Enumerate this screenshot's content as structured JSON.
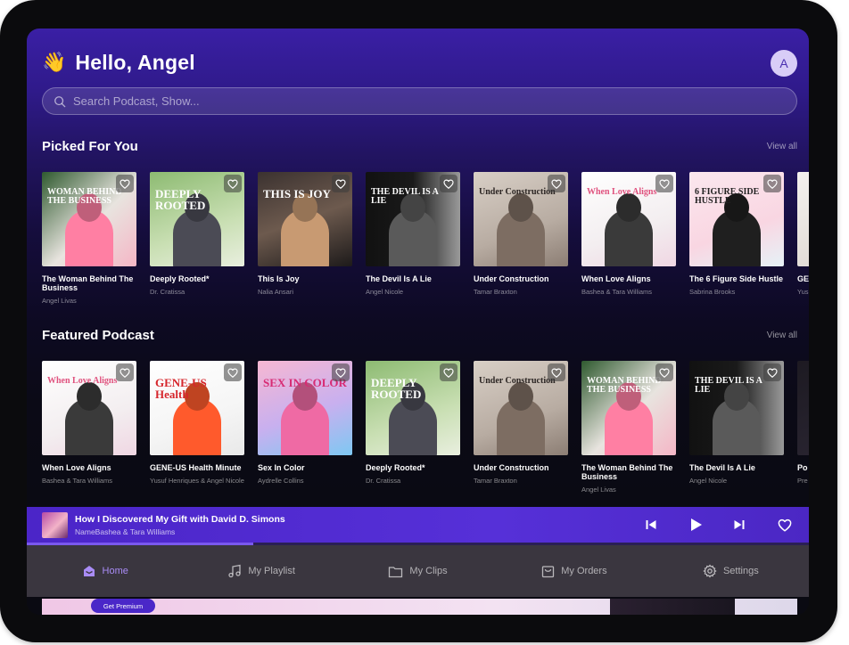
{
  "header": {
    "wave": "👋",
    "greeting": "Hello, Angel",
    "avatar_initial": "A"
  },
  "search": {
    "placeholder": "Search Podcast, Show..."
  },
  "picked": {
    "title": "Picked For You",
    "view_all": "View all",
    "items": [
      {
        "title": "The Woman Behind The Business",
        "sub": "Angel Livas",
        "cover_text": "WOMAN BEHIND THE BUSINESS",
        "bg": "linear-gradient(135deg,#2f5a2f,#e8e4df 55%,#f5b6c6)",
        "text_color": "#ffffff",
        "person": "#ff7fa3"
      },
      {
        "title": "Deeply Rooted*",
        "sub": "Dr. Cratissa",
        "cover_text": "DEEPLY ROOTED",
        "bg": "linear-gradient(160deg,#8dbb72,#c9dfb3 60%,#e9efdf)",
        "text_color": "#ffffff",
        "person": "#4b4b55"
      },
      {
        "title": "This Is Joy",
        "sub": "Nalia Ansari",
        "cover_text": "THIS IS JOY",
        "bg": "linear-gradient(160deg,#3b3230,#6d5a4e 50%,#1d1a1a)",
        "text_color": "#ffffff",
        "person": "#c89a72"
      },
      {
        "title": "The Devil Is A Lie",
        "sub": "Angel Nicole",
        "cover_text": "THE DEVIL IS A LIE",
        "bg": "linear-gradient(90deg,#111 0%,#1a1a1a 50%,#9a9a9a 100%)",
        "text_color": "#ffffff",
        "person": "#5a5a5a"
      },
      {
        "title": "Under Construction",
        "sub": "Tamar Braxton",
        "cover_text": "Under Construction",
        "bg": "linear-gradient(160deg,#d8cfc6,#b8aca2 60%,#8c7e74)",
        "text_color": "#2b2523",
        "person": "#7d6d62"
      },
      {
        "title": "When Love Aligns",
        "sub": "Bashea & Tara Williams",
        "cover_text": "When Love Aligns",
        "bg": "linear-gradient(160deg,#ffffff,#f3eef0 60%,#f0d7e3)",
        "text_color": "#e0517e",
        "person": "#3a3a3a"
      },
      {
        "title": "The 6 Figure Side Hustle",
        "sub": "Sabrina Brooks",
        "cover_text": "6 FIGURE SIDE HUSTLE",
        "bg": "linear-gradient(160deg,#fbe7ee,#f9d6e2 60%,#e6f2f7)",
        "text_color": "#222222",
        "person": "#1f1f1f"
      },
      {
        "title": "GE",
        "sub": "Yus Nic",
        "cover_text": "",
        "bg": "linear-gradient(160deg,#f4f1ee,#dcd6d0)",
        "text_color": "#222222",
        "person": "#cfcfcf"
      }
    ]
  },
  "featured": {
    "title": "Featured Podcast",
    "view_all": "View all",
    "items": [
      {
        "title": "When Love Aligns",
        "sub": "Bashea & Tara Williams",
        "cover_text": "When Love Aligns",
        "bg": "linear-gradient(160deg,#ffffff,#f3eef0 60%,#f0d7e3)",
        "text_color": "#e0517e",
        "person": "#3a3a3a"
      },
      {
        "title": "GENE-US Health Minute",
        "sub": "Yusuf Henriques & Angel Nicole",
        "cover_text": "GENE-US Health",
        "bg": "linear-gradient(160deg,#ffffff,#f5f5f5 60%,#e9e9e9)",
        "text_color": "#d6262c",
        "person": "#ff5a2c"
      },
      {
        "title": "Sex In Color",
        "sub": "Aydrelle Collins",
        "cover_text": "SEX IN COLOR",
        "bg": "linear-gradient(160deg,#f7b7d2,#c8b0ef 55%,#7ec8f2)",
        "text_color": "#d72b74",
        "person": "#ef6aa4"
      },
      {
        "title": "Deeply Rooted*",
        "sub": "Dr. Cratissa",
        "cover_text": "DEEPLY ROOTED",
        "bg": "linear-gradient(160deg,#8dbb72,#c9dfb3 60%,#e9efdf)",
        "text_color": "#ffffff",
        "person": "#4b4b55"
      },
      {
        "title": "Under Construction",
        "sub": "Tamar Braxton",
        "cover_text": "Under Construction",
        "bg": "linear-gradient(160deg,#d8cfc6,#b8aca2 60%,#8c7e74)",
        "text_color": "#2b2523",
        "person": "#7d6d62"
      },
      {
        "title": "The Woman Behind The Business",
        "sub": "Angel Livas",
        "cover_text": "WOMAN BEHIND THE BUSINESS",
        "bg": "linear-gradient(135deg,#2f5a2f,#e8e4df 55%,#f5b6c6)",
        "text_color": "#ffffff",
        "person": "#ff7fa3"
      },
      {
        "title": "The Devil Is A Lie",
        "sub": "Angel Nicole",
        "cover_text": "THE DEVIL IS A LIE",
        "bg": "linear-gradient(90deg,#111 0%,#1a1a1a 50%,#9a9a9a 100%)",
        "text_color": "#ffffff",
        "person": "#5a5a5a"
      },
      {
        "title": "Po",
        "sub": "Pre",
        "cover_text": "",
        "bg": "linear-gradient(160deg,#1d1a22,#2b2633)",
        "text_color": "#ffffff",
        "person": "#2b2633"
      }
    ]
  },
  "player": {
    "title": "How I Discovered My Gift with David D. Simons",
    "artist": "NameBashea & Tara Williams",
    "progress_fraction": 0.29,
    "colors": {
      "accent": "#5630d8",
      "progress": "#7a58ee"
    }
  },
  "tabs": [
    {
      "label": "Home",
      "icon": "home-icon",
      "active": true
    },
    {
      "label": "My Playlist",
      "icon": "music-note-icon",
      "active": false
    },
    {
      "label": "My Clips",
      "icon": "folder-icon",
      "active": false
    },
    {
      "label": "My Orders",
      "icon": "shopping-bag-icon",
      "active": false
    },
    {
      "label": "Settings",
      "icon": "gear-icon",
      "active": false
    }
  ],
  "promo": {
    "button_label": "Get Premium"
  }
}
